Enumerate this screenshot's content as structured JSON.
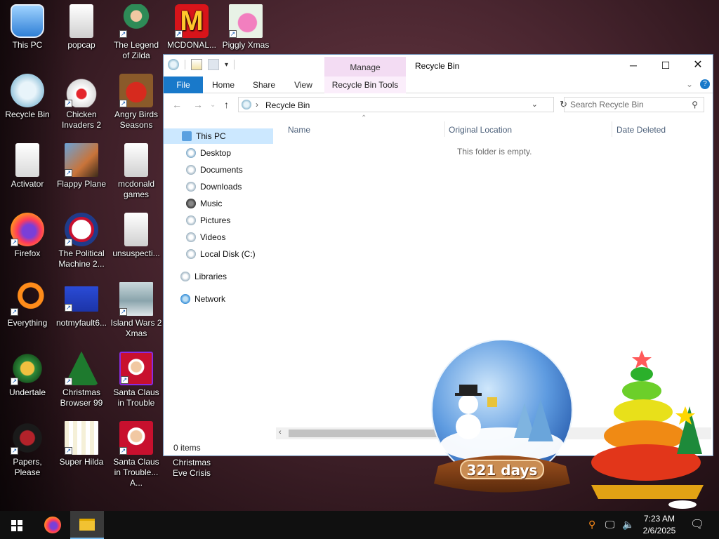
{
  "desktop": {
    "icons": [
      {
        "label": "This PC",
        "icon": "monitor-icon",
        "shortcut": false
      },
      {
        "label": "popcap",
        "icon": "folder-icon",
        "shortcut": false
      },
      {
        "label": "The Legend of Zilda",
        "icon": "game-character-icon",
        "shortcut": true
      },
      {
        "label": "MCDONAL...",
        "icon": "mcdonalds-logo-icon",
        "shortcut": true
      },
      {
        "label": "Piggly Xmas",
        "icon": "pig-icon",
        "shortcut": true
      },
      {
        "label": "Recycle Bin",
        "icon": "recycle-bin-icon",
        "shortcut": false
      },
      {
        "label": "Chicken Invaders 2",
        "icon": "chicken-icon",
        "shortcut": true
      },
      {
        "label": "Angry Birds Seasons",
        "icon": "angry-birds-icon",
        "shortcut": true
      },
      {
        "label": "Activator",
        "icon": "folder-icon",
        "shortcut": false
      },
      {
        "label": "Flappy Plane",
        "icon": "flappy-plane-icon",
        "shortcut": true
      },
      {
        "label": "mcdonald games",
        "icon": "folder-icon",
        "shortcut": false
      },
      {
        "label": "Firefox",
        "icon": "firefox-icon",
        "shortcut": true
      },
      {
        "label": "The Political Machine 2...",
        "icon": "political-machine-icon",
        "shortcut": true
      },
      {
        "label": "unsuspecti...",
        "icon": "folder-icon",
        "shortcut": false
      },
      {
        "label": "Everything",
        "icon": "everything-search-icon",
        "shortcut": true
      },
      {
        "label": "notmyfault6...",
        "icon": "bluescreen-icon",
        "shortcut": true
      },
      {
        "label": "Island Wars 2 Xmas",
        "icon": "island-wars-icon",
        "shortcut": true
      },
      {
        "label": "Undertale",
        "icon": "undertale-icon",
        "shortcut": true
      },
      {
        "label": "Christmas Browser 99",
        "icon": "christmas-tree-icon",
        "shortcut": true
      },
      {
        "label": "Santa Claus in Trouble",
        "icon": "santa-icon",
        "shortcut": true
      },
      {
        "label": "Papers, Please",
        "icon": "papers-please-icon",
        "shortcut": true
      },
      {
        "label": "Super Hilda",
        "icon": "pixel-character-icon",
        "shortcut": true
      },
      {
        "label": "Santa Claus in Trouble... A...",
        "icon": "santa-icon",
        "shortcut": true
      },
      {
        "label": "Christmas Eve Crisis",
        "icon": "",
        "shortcut": false
      }
    ]
  },
  "window": {
    "title": "Recycle Bin",
    "manage_label": "Manage",
    "ribbon_tabs": [
      "File",
      "Home",
      "Share",
      "View",
      "Recycle Bin Tools"
    ],
    "address_path": "Recycle Bin",
    "search_placeholder": "Search Recycle Bin",
    "nav_items": [
      "This PC",
      "Desktop",
      "Documents",
      "Downloads",
      "Music",
      "Pictures",
      "Videos",
      "Local Disk (C:)",
      "Libraries",
      "Network"
    ],
    "columns": [
      "Name",
      "Original Location",
      "Date Deleted"
    ],
    "empty_message": "This folder is empty.",
    "status": "0 items"
  },
  "widgets": {
    "countdown": "321 days"
  },
  "taskbar": {
    "time": "7:23 AM",
    "date": "2/6/2025"
  },
  "colors": {
    "accent": "#1979ca",
    "manage_tab": "#f3dcf3",
    "selection": "#cce8ff"
  }
}
